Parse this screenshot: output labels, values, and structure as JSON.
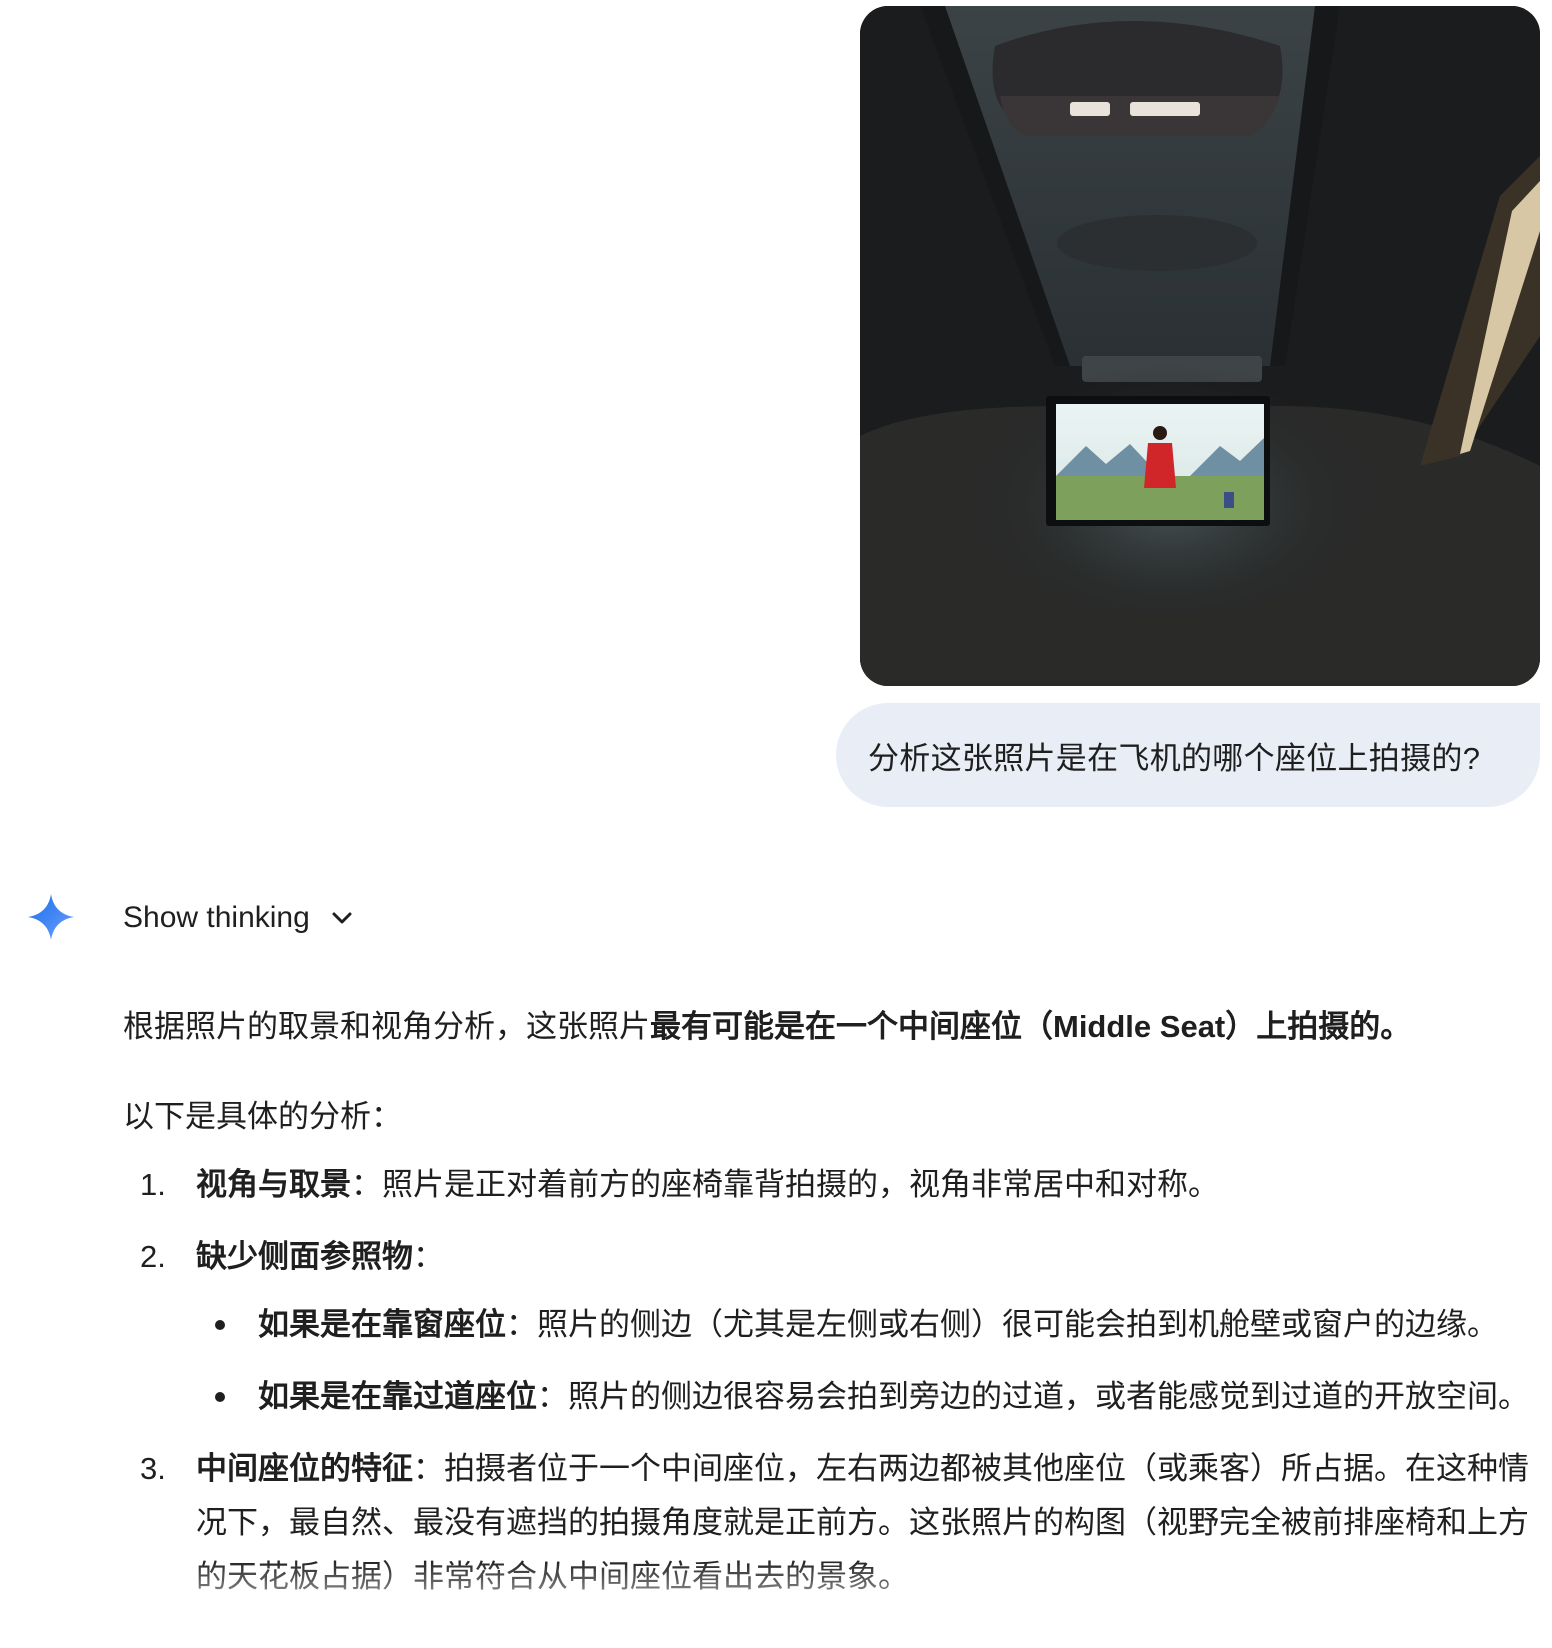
{
  "user_message": {
    "prompt": "分析这张照片是在飞机的哪个座位上拍摄的?"
  },
  "assistant": {
    "show_thinking_label": "Show thinking",
    "intro_prefix": "根据照片的取景和视角分析，这张照片",
    "intro_bold": "最有可能是在一个中间座位（Middle Seat）上拍摄的。",
    "lead": "以下是具体的分析：",
    "points": [
      {
        "num": "1.",
        "title": "视角与取景",
        "sep": "：",
        "text": "照片是正对着前方的座椅靠背拍摄的，视角非常居中和对称。"
      },
      {
        "num": "2.",
        "title": "缺少侧面参照物",
        "sep": "：",
        "text": "",
        "sub": [
          {
            "title": "如果是在靠窗座位",
            "sep": "：",
            "text": "照片的侧边（尤其是左侧或右侧）很可能会拍到机舱壁或窗户的边缘。"
          },
          {
            "title": "如果是在靠过道座位",
            "sep": "：",
            "text": "照片的侧边很容易会拍到旁边的过道，或者能感觉到过道的开放空间。"
          }
        ]
      },
      {
        "num": "3.",
        "title": "中间座位的特征",
        "sep": "：",
        "text": "拍摄者位于一个中间座位，左右两边都被其他座位（或乘客）所占据。在这种情况下，最自然、最没有遮挡的拍摄角度就是正前方。这张照片的构图（视野完全被前排座椅和上方的天花板占据）非常符合从中间座位看出去的景象。"
      }
    ]
  },
  "colors": {
    "bubble_bg": "#e9eef6",
    "text": "#1f1f1f",
    "gemini_blue": "#4285f4"
  }
}
